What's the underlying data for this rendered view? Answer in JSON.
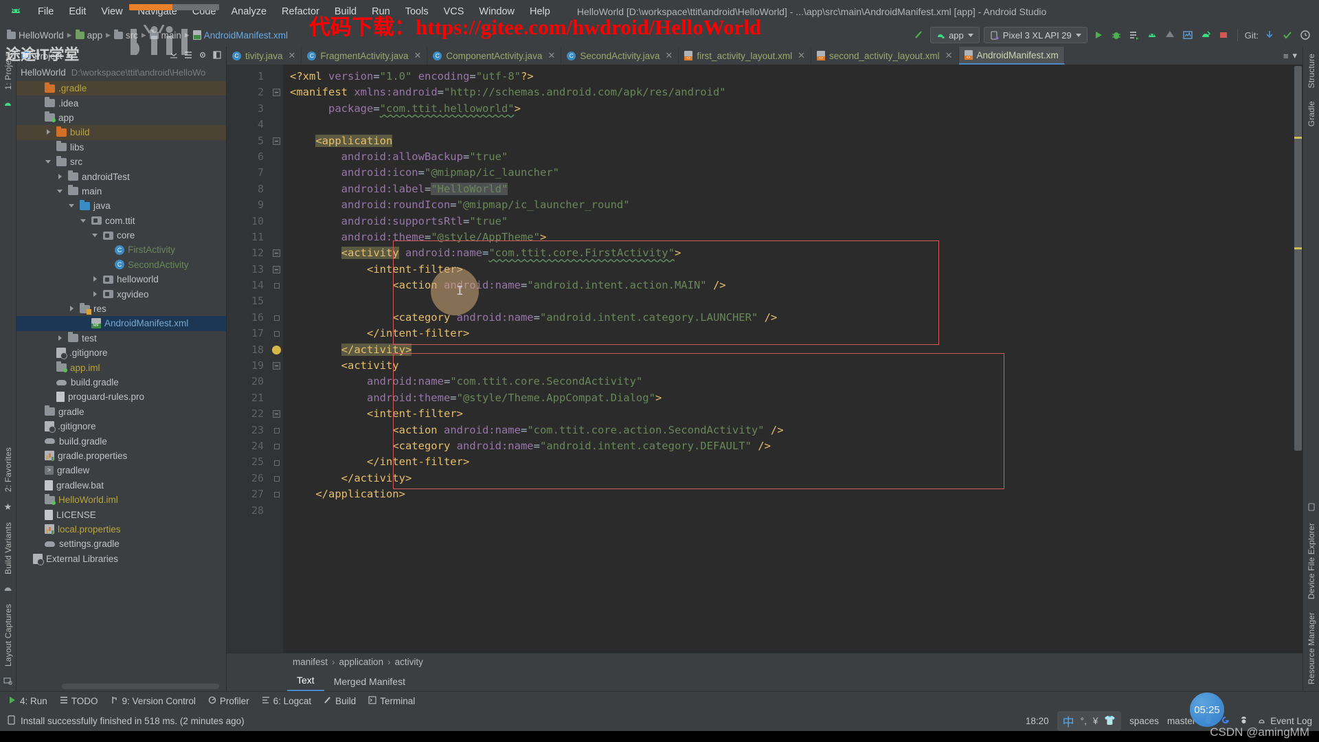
{
  "window": {
    "title": "HelloWorld [D:\\workspace\\ttit\\android\\HelloWorld] - ...\\app\\src\\main\\AndroidManifest.xml [app] - Android Studio",
    "app_icon": "android-studio-icon"
  },
  "menu": [
    {
      "label": "File"
    },
    {
      "label": "Edit"
    },
    {
      "label": "View"
    },
    {
      "label": "Navigate"
    },
    {
      "label": "Code"
    },
    {
      "label": "Analyze"
    },
    {
      "label": "Refactor"
    },
    {
      "label": "Build"
    },
    {
      "label": "Run"
    },
    {
      "label": "Tools"
    },
    {
      "label": "VCS"
    },
    {
      "label": "Window"
    },
    {
      "label": "Help"
    }
  ],
  "navbar": {
    "crumbs": [
      "HelloWorld",
      "app",
      "src",
      "main",
      "AndroidManifest.xml"
    ],
    "run_config": "app",
    "device": "Pixel 3 XL API 29",
    "git_label": "Git:"
  },
  "project_panel": {
    "header": "Project",
    "root_name": "HelloWorld",
    "root_path": "D:\\workspace\\ttit\\android\\HelloWo",
    "tree": [
      {
        "label": ".gradle",
        "indent": 1,
        "icon": "folder-orange",
        "arrow": "none",
        "state": "highlighted",
        "color": "yellow"
      },
      {
        "label": ".idea",
        "indent": 1,
        "icon": "folder",
        "arrow": "none",
        "state": "",
        "color": "white"
      },
      {
        "label": "app",
        "indent": 1,
        "icon": "folder-module",
        "arrow": "none",
        "state": "",
        "color": "white"
      },
      {
        "label": "build",
        "indent": 2,
        "icon": "folder-orange",
        "arrow": "right",
        "state": "highlighted",
        "color": "yellow"
      },
      {
        "label": "libs",
        "indent": 2,
        "icon": "folder",
        "arrow": "none",
        "state": "",
        "color": "white"
      },
      {
        "label": "src",
        "indent": 2,
        "icon": "folder",
        "arrow": "down",
        "state": "",
        "color": "white"
      },
      {
        "label": "androidTest",
        "indent": 3,
        "icon": "folder",
        "arrow": "right",
        "state": "",
        "color": "white"
      },
      {
        "label": "main",
        "indent": 3,
        "icon": "folder",
        "arrow": "down",
        "state": "",
        "color": "white"
      },
      {
        "label": "java",
        "indent": 4,
        "icon": "folder-blue",
        "arrow": "down",
        "state": "",
        "color": "white"
      },
      {
        "label": "com.ttit",
        "indent": 5,
        "icon": "package",
        "arrow": "down",
        "state": "",
        "color": "white"
      },
      {
        "label": "core",
        "indent": 6,
        "icon": "package",
        "arrow": "down",
        "state": "",
        "color": "white"
      },
      {
        "label": "FirstActivity",
        "indent": 7,
        "icon": "class",
        "arrow": "none",
        "state": "",
        "color": "green"
      },
      {
        "label": "SecondActivity",
        "indent": 7,
        "icon": "class",
        "arrow": "none",
        "state": "",
        "color": "green"
      },
      {
        "label": "helloworld",
        "indent": 6,
        "icon": "package",
        "arrow": "right",
        "state": "",
        "color": "white"
      },
      {
        "label": "xgvideo",
        "indent": 6,
        "icon": "package",
        "arrow": "right",
        "state": "",
        "color": "white"
      },
      {
        "label": "res",
        "indent": 4,
        "icon": "folder-res",
        "arrow": "right",
        "state": "",
        "color": "white"
      },
      {
        "label": "AndroidManifest.xml",
        "indent": 5,
        "icon": "manifest",
        "arrow": "none",
        "state": "selected",
        "color": "blue"
      },
      {
        "label": "test",
        "indent": 3,
        "icon": "folder",
        "arrow": "right",
        "state": "",
        "color": "white"
      },
      {
        "label": ".gitignore",
        "indent": 2,
        "icon": "gitignore",
        "arrow": "none",
        "state": "",
        "color": "white"
      },
      {
        "label": "app.iml",
        "indent": 2,
        "icon": "iml",
        "arrow": "none",
        "state": "",
        "color": "yellow"
      },
      {
        "label": "build.gradle",
        "indent": 2,
        "icon": "gradle",
        "arrow": "none",
        "state": "",
        "color": "white"
      },
      {
        "label": "proguard-rules.pro",
        "indent": 2,
        "icon": "text",
        "arrow": "none",
        "state": "",
        "color": "white"
      },
      {
        "label": "gradle",
        "indent": 1,
        "icon": "folder",
        "arrow": "none",
        "state": "",
        "color": "white"
      },
      {
        "label": ".gitignore",
        "indent": 1,
        "icon": "gitignore",
        "arrow": "none",
        "state": "",
        "color": "white"
      },
      {
        "label": "build.gradle",
        "indent": 1,
        "icon": "gradle",
        "arrow": "none",
        "state": "",
        "color": "white"
      },
      {
        "label": "gradle.properties",
        "indent": 1,
        "icon": "properties",
        "arrow": "none",
        "state": "",
        "color": "white"
      },
      {
        "label": "gradlew",
        "indent": 1,
        "icon": "shell",
        "arrow": "none",
        "state": "",
        "color": "white"
      },
      {
        "label": "gradlew.bat",
        "indent": 1,
        "icon": "bat",
        "arrow": "none",
        "state": "",
        "color": "white"
      },
      {
        "label": "HelloWorld.iml",
        "indent": 1,
        "icon": "iml",
        "arrow": "none",
        "state": "",
        "color": "yellow"
      },
      {
        "label": "LICENSE",
        "indent": 1,
        "icon": "text",
        "arrow": "none",
        "state": "",
        "color": "white"
      },
      {
        "label": "local.properties",
        "indent": 1,
        "icon": "properties",
        "arrow": "none",
        "state": "",
        "color": "yellow"
      },
      {
        "label": "settings.gradle",
        "indent": 1,
        "icon": "gradle",
        "arrow": "none",
        "state": "",
        "color": "white"
      },
      {
        "label": "External Libraries",
        "indent": 0,
        "icon": "ext",
        "arrow": "none",
        "state": "",
        "color": "white"
      }
    ]
  },
  "left_rail": [
    "1: Project",
    "2: Favorites",
    "Build Variants",
    "Layout Captures"
  ],
  "right_rail": [
    "Structure",
    "Gradle",
    "Device File Explorer",
    "Resource Manager"
  ],
  "editor_tabs": [
    {
      "label": "tivity.java",
      "icon": "java-class-icon",
      "active": false,
      "closable": true
    },
    {
      "label": "FragmentActivity.java",
      "icon": "java-class-icon",
      "active": false,
      "closable": true
    },
    {
      "label": "ComponentActivity.java",
      "icon": "java-class-icon",
      "active": false,
      "closable": true
    },
    {
      "label": "SecondActivity.java",
      "icon": "java-class-icon",
      "active": false,
      "closable": true
    },
    {
      "label": "first_activity_layout.xml",
      "icon": "xml-file-icon",
      "active": false,
      "closable": true
    },
    {
      "label": "second_activity_layout.xml",
      "icon": "xml-file-icon",
      "active": false,
      "closable": true
    },
    {
      "label": "AndroidManifest.xm",
      "icon": "manifest-icon",
      "active": true,
      "closable": false
    }
  ],
  "code": {
    "first_line": 1,
    "lines": [
      {
        "n": 1,
        "tokens": [
          {
            "t": "<?xml ",
            "c": "tag"
          },
          {
            "t": "version",
            "c": "attr"
          },
          {
            "t": "=",
            "c": "plain"
          },
          {
            "t": "\"1.0\"",
            "c": "str"
          },
          {
            "t": " ",
            "c": "plain"
          },
          {
            "t": "encoding",
            "c": "attr"
          },
          {
            "t": "=",
            "c": "plain"
          },
          {
            "t": "\"utf-8\"",
            "c": "str"
          },
          {
            "t": "?>",
            "c": "tag"
          }
        ]
      },
      {
        "n": 2,
        "tokens": [
          {
            "t": "<manifest",
            "c": "tag"
          },
          {
            "t": " ",
            "c": "plain"
          },
          {
            "t": "xmlns:android",
            "c": "attr"
          },
          {
            "t": "=",
            "c": "plain"
          },
          {
            "t": "\"http://schemas.android.com/apk/res/android\"",
            "c": "str"
          }
        ]
      },
      {
        "n": 3,
        "tokens": [
          {
            "t": "      package",
            "c": "attr"
          },
          {
            "t": "=",
            "c": "plain"
          },
          {
            "t": "\"com.ttit.helloworld\"",
            "c": "str-squig"
          },
          {
            "t": ">",
            "c": "tag"
          }
        ]
      },
      {
        "n": 4,
        "tokens": []
      },
      {
        "n": 5,
        "tokens": [
          {
            "t": "    ",
            "c": "plain"
          },
          {
            "t": "<application",
            "c": "tag-hl"
          }
        ]
      },
      {
        "n": 6,
        "tokens": [
          {
            "t": "        android:allowBackup",
            "c": "attr"
          },
          {
            "t": "=",
            "c": "plain"
          },
          {
            "t": "\"true\"",
            "c": "str"
          }
        ]
      },
      {
        "n": 7,
        "tokens": [
          {
            "t": "        android:icon",
            "c": "attr"
          },
          {
            "t": "=",
            "c": "plain"
          },
          {
            "t": "\"@mipmap/ic_launcher\"",
            "c": "str"
          }
        ]
      },
      {
        "n": 8,
        "tokens": [
          {
            "t": "        android:label",
            "c": "attr"
          },
          {
            "t": "=",
            "c": "plain"
          },
          {
            "t": "\"HelloWorld\"",
            "c": "str-hl2"
          }
        ]
      },
      {
        "n": 9,
        "tokens": [
          {
            "t": "        android:roundIcon",
            "c": "attr"
          },
          {
            "t": "=",
            "c": "plain"
          },
          {
            "t": "\"@mipmap/ic_launcher_round\"",
            "c": "str"
          }
        ]
      },
      {
        "n": 10,
        "tokens": [
          {
            "t": "        android:supportsRtl",
            "c": "attr"
          },
          {
            "t": "=",
            "c": "plain"
          },
          {
            "t": "\"true\"",
            "c": "str"
          }
        ]
      },
      {
        "n": 11,
        "tokens": [
          {
            "t": "        android:theme",
            "c": "attr"
          },
          {
            "t": "=",
            "c": "plain"
          },
          {
            "t": "\"@style/AppTheme\"",
            "c": "str"
          },
          {
            "t": ">",
            "c": "tag"
          }
        ]
      },
      {
        "n": 12,
        "tokens": [
          {
            "t": "        ",
            "c": "plain"
          },
          {
            "t": "<activity",
            "c": "tag-hl"
          },
          {
            "t": " ",
            "c": "plain"
          },
          {
            "t": "android:name",
            "c": "attr"
          },
          {
            "t": "=",
            "c": "plain"
          },
          {
            "t": "\"com.ttit.core.FirstActivity\"",
            "c": "str-squig"
          },
          {
            "t": ">",
            "c": "tag"
          }
        ]
      },
      {
        "n": 13,
        "tokens": [
          {
            "t": "            ",
            "c": "plain"
          },
          {
            "t": "<intent-filter>",
            "c": "tag"
          }
        ]
      },
      {
        "n": 14,
        "tokens": [
          {
            "t": "                ",
            "c": "plain"
          },
          {
            "t": "<action",
            "c": "tag"
          },
          {
            "t": " ",
            "c": "plain"
          },
          {
            "t": "android:name",
            "c": "attr"
          },
          {
            "t": "=",
            "c": "plain"
          },
          {
            "t": "\"android.intent.action.MAIN\"",
            "c": "str"
          },
          {
            "t": " />",
            "c": "tag"
          }
        ]
      },
      {
        "n": 15,
        "tokens": []
      },
      {
        "n": 16,
        "tokens": [
          {
            "t": "                ",
            "c": "plain"
          },
          {
            "t": "<category",
            "c": "tag"
          },
          {
            "t": " ",
            "c": "plain"
          },
          {
            "t": "android:name",
            "c": "attr"
          },
          {
            "t": "=",
            "c": "plain"
          },
          {
            "t": "\"android.intent.category.LAUNCHER\"",
            "c": "str"
          },
          {
            "t": " />",
            "c": "tag"
          }
        ]
      },
      {
        "n": 17,
        "tokens": [
          {
            "t": "            ",
            "c": "plain"
          },
          {
            "t": "</intent-filter>",
            "c": "tag"
          }
        ]
      },
      {
        "n": 18,
        "tokens": [
          {
            "t": "        ",
            "c": "plain"
          },
          {
            "t": "</activity>",
            "c": "tag-hl"
          }
        ]
      },
      {
        "n": 19,
        "tokens": [
          {
            "t": "        ",
            "c": "plain"
          },
          {
            "t": "<activity",
            "c": "tag"
          }
        ]
      },
      {
        "n": 20,
        "tokens": [
          {
            "t": "            android:name",
            "c": "attr"
          },
          {
            "t": "=",
            "c": "plain"
          },
          {
            "t": "\"com.ttit.core.SecondActivity\"",
            "c": "str"
          }
        ]
      },
      {
        "n": 21,
        "tokens": [
          {
            "t": "            android:theme",
            "c": "attr"
          },
          {
            "t": "=",
            "c": "plain"
          },
          {
            "t": "\"@style/Theme.AppCompat.Dialog\"",
            "c": "str"
          },
          {
            "t": ">",
            "c": "tag"
          }
        ]
      },
      {
        "n": 22,
        "tokens": [
          {
            "t": "            ",
            "c": "plain"
          },
          {
            "t": "<intent-filter>",
            "c": "tag"
          }
        ]
      },
      {
        "n": 23,
        "tokens": [
          {
            "t": "                ",
            "c": "plain"
          },
          {
            "t": "<action",
            "c": "tag"
          },
          {
            "t": " ",
            "c": "plain"
          },
          {
            "t": "android:name",
            "c": "attr"
          },
          {
            "t": "=",
            "c": "plain"
          },
          {
            "t": "\"com.ttit.core.action.SecondActivity\"",
            "c": "str"
          },
          {
            "t": " />",
            "c": "tag"
          }
        ]
      },
      {
        "n": 24,
        "tokens": [
          {
            "t": "                ",
            "c": "plain"
          },
          {
            "t": "<category",
            "c": "tag"
          },
          {
            "t": " ",
            "c": "plain"
          },
          {
            "t": "android:name",
            "c": "attr"
          },
          {
            "t": "=",
            "c": "plain"
          },
          {
            "t": "\"android.intent.category.DEFAULT\"",
            "c": "str"
          },
          {
            "t": " />",
            "c": "tag"
          }
        ]
      },
      {
        "n": 25,
        "tokens": [
          {
            "t": "            ",
            "c": "plain"
          },
          {
            "t": "</intent-filter>",
            "c": "tag"
          }
        ]
      },
      {
        "n": 26,
        "tokens": [
          {
            "t": "        ",
            "c": "plain"
          },
          {
            "t": "</activity>",
            "c": "tag"
          }
        ]
      },
      {
        "n": 27,
        "tokens": [
          {
            "t": "    ",
            "c": "plain"
          },
          {
            "t": "</application>",
            "c": "tag"
          }
        ]
      },
      {
        "n": 28,
        "tokens": []
      }
    ]
  },
  "xml_breadcrumb": [
    "manifest",
    "application",
    "activity"
  ],
  "bottom_tabs": [
    {
      "label": "Text",
      "active": true
    },
    {
      "label": "Merged Manifest",
      "active": false
    }
  ],
  "tool_windows": [
    {
      "label": "4: Run",
      "icon": "run-icon"
    },
    {
      "label": "TODO",
      "icon": "todo-icon"
    },
    {
      "label": "9: Version Control",
      "icon": "vcs-icon"
    },
    {
      "label": "Profiler",
      "icon": "profiler-icon"
    },
    {
      "label": "6: Logcat",
      "icon": "logcat-icon"
    },
    {
      "label": "Build",
      "icon": "build-icon"
    },
    {
      "label": "Terminal",
      "icon": "terminal-icon"
    }
  ],
  "status": {
    "message": "Install successfully finished in 518 ms. (2 minutes ago)",
    "time": "18:20",
    "spaces": "spaces",
    "branch": "master",
    "event_log": "Event Log",
    "ime_items": [
      "中",
      "°,",
      "¥",
      "shirt-icon"
    ]
  },
  "watermarks": {
    "gitee": "代码下载：https://gitee.com/hwdroid/HelloWorld",
    "ttit": "途途IT学堂",
    "bilibili": "bilibili",
    "csdn": "CSDN @amingMM",
    "clock": "05:25"
  },
  "colors": {
    "accent_blue": "#4a88c7",
    "selection_blue": "#1b3754",
    "folder_orange": "#d2702a",
    "string_green": "#6a8759",
    "tag_yellow": "#e8bf6a",
    "attr_purple": "#9876aa",
    "watermark_red": "#ff0000",
    "red_box": "#d25c5c"
  }
}
